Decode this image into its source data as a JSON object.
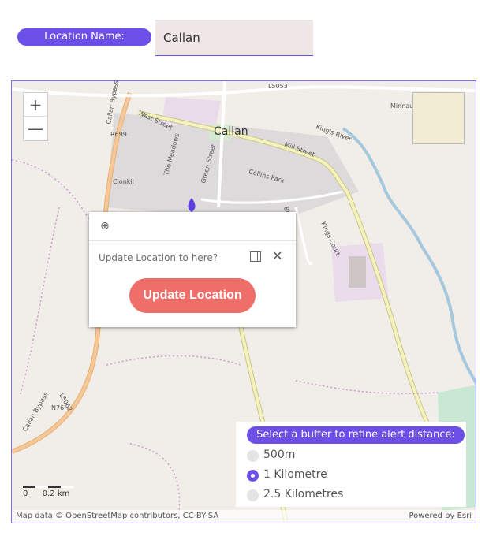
{
  "location": {
    "label": "Location Name:",
    "value": "Callan"
  },
  "map": {
    "zoom_in": "+",
    "zoom_out": "—",
    "town_label": "Callan",
    "street_labels": [
      "L5053",
      "Callan Bypass",
      "West Street",
      "R699",
      "Green Street",
      "The Meadows",
      "Collins Park",
      "Mill Street",
      "King's River",
      "Minnaun",
      "Clonkil",
      "Bolton",
      "Kings Court",
      "L5062",
      "N76",
      "Callan Bypass"
    ],
    "scale": {
      "labels": [
        "0",
        "0.2 km"
      ]
    },
    "attribution_left": "Map data © OpenStreetMap contributors, CC-BY-SA",
    "attribution_right": "Powered by Esri"
  },
  "popup": {
    "zoom_to_icon": "zoom-to-icon",
    "title": "Update Location to here?",
    "button": "Update Location"
  },
  "buffer": {
    "title": "Select a buffer to refine alert distance:",
    "options": [
      {
        "label": "500m",
        "selected": false
      },
      {
        "label": "1 Kilometre",
        "selected": true
      },
      {
        "label": "2.5 Kilometres",
        "selected": false
      }
    ]
  },
  "colors": {
    "accent": "#6b4fe6",
    "button": "#ee6f6a",
    "map_bg": "#f1eee9"
  }
}
